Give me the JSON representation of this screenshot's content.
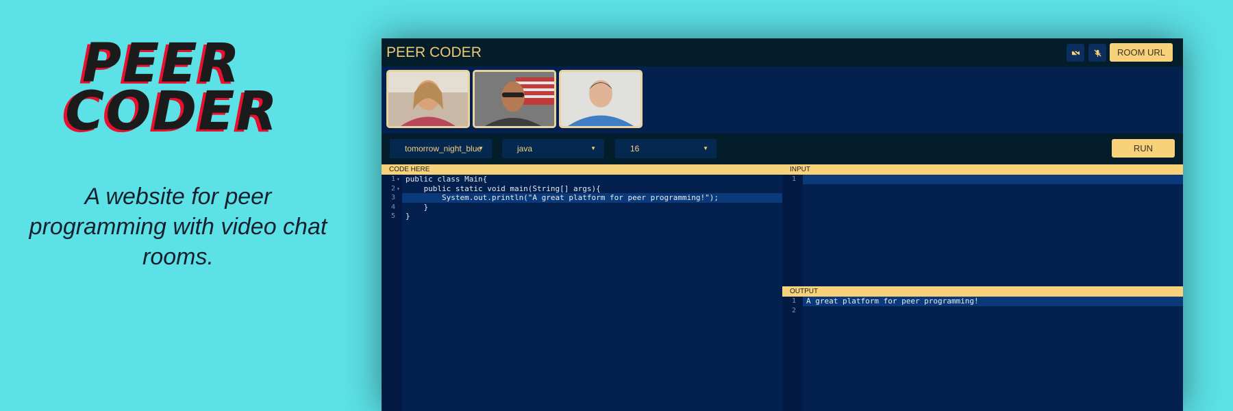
{
  "promo": {
    "logo_line1": "PEER",
    "logo_line2": "CODER",
    "tagline": "A website for peer programming with video chat rooms."
  },
  "app": {
    "title": "PEER CODER",
    "header": {
      "video_toggle_icon": "video-off-icon",
      "mic_toggle_icon": "mic-off-icon",
      "room_url_label": "ROOM URL"
    },
    "participants": [
      {
        "name": "participant-1"
      },
      {
        "name": "participant-2"
      },
      {
        "name": "participant-3"
      }
    ],
    "toolbar": {
      "theme": "tomorrow_night_blue",
      "language": "java",
      "font_size": "16",
      "run_label": "RUN"
    },
    "editor": {
      "label": "CODE HERE",
      "lines": [
        {
          "n": "1",
          "fold": true,
          "code": "public class Main{"
        },
        {
          "n": "2",
          "fold": true,
          "code": "    public static void main(String[] args){"
        },
        {
          "n": "3",
          "fold": false,
          "code": "        System.out.println(\"A great platform for peer programming!\");",
          "highlight": true
        },
        {
          "n": "4",
          "fold": false,
          "code": "    }"
        },
        {
          "n": "5",
          "fold": false,
          "code": "}"
        }
      ]
    },
    "input": {
      "label": "INPUT",
      "lines": [
        {
          "n": "1",
          "code": ""
        }
      ]
    },
    "output": {
      "label": "OUTPUT",
      "lines": [
        {
          "n": "1",
          "code": "A great platform for peer programming!"
        },
        {
          "n": "2",
          "code": ""
        }
      ]
    }
  },
  "colors": {
    "background": "#5ce1e6",
    "accent": "#f7d27b",
    "editor_bg": "#03204f",
    "header_bg": "#031d2b"
  }
}
